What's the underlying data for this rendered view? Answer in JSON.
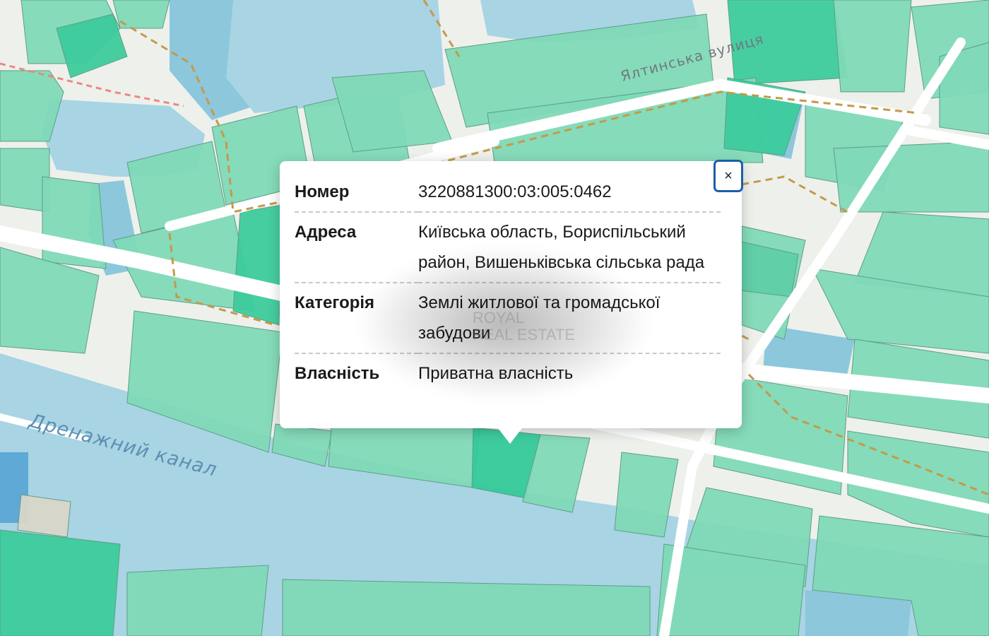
{
  "map": {
    "canal_label": "Дренажний канал",
    "street_label": "Ялтинська вулиця",
    "colors": {
      "land": "#eef0ec",
      "parcel": "#7fd9b7",
      "parcel_dark": "#3ccb9c",
      "water": "#a8d4e4",
      "water_deep": "#8cc7dc",
      "road": "#ffffff",
      "boundary": "#c49a4a",
      "selected_parcel": "#34c99a"
    }
  },
  "popup": {
    "close_label": "×",
    "rows": [
      {
        "key": "Номер",
        "value": "3220881300:03:005:0462"
      },
      {
        "key": "Адреса",
        "value": "Київська область, Бориспільський район, Вишеньківська сільська рада"
      },
      {
        "key": "Категорія",
        "value": "Землі житлової та громадської забудови"
      },
      {
        "key": "Власність",
        "value": "Приватна власність"
      }
    ]
  },
  "watermark": {
    "line1": "ROYAL",
    "line2": "REAL ESTATE"
  }
}
